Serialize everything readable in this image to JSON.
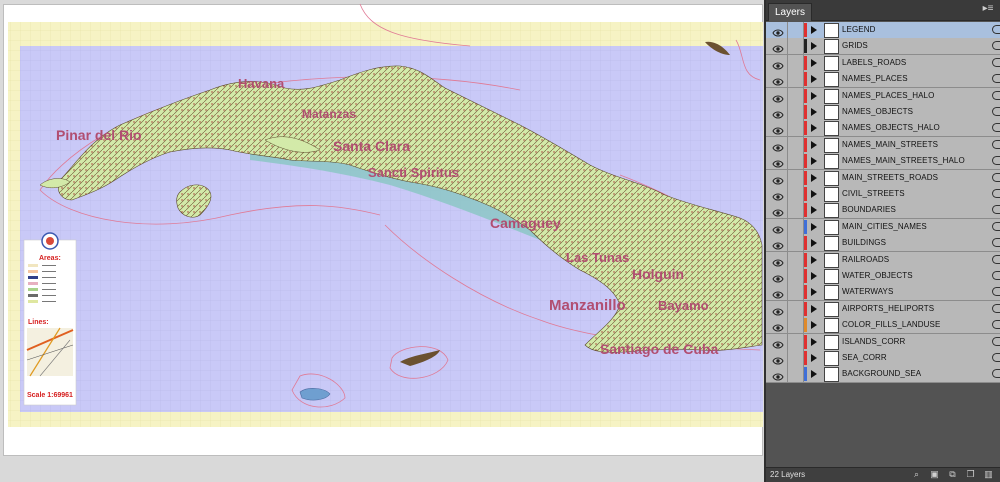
{
  "map": {
    "labels": {
      "havana": "Havana",
      "pinar": "Pinar del Rio",
      "matanzas": "Matanzas",
      "santa_clara": "Santa Clara",
      "sancti": "Sancti Spiritus",
      "camaguey": "Camaguey",
      "las_tunas": "Las Tunas",
      "holguin": "Holguin",
      "bayamo": "Bayamo",
      "manzanillo": "Manzanillo",
      "santiago": "Santiago de Cuba"
    },
    "legend": {
      "areas_title": "Areas:",
      "lines_title": "Lines:",
      "scale": "Scale 1:69961"
    },
    "colors": {
      "sea": "#c9c9f7",
      "land": "#d6ecb1",
      "halo": "#f6f3c4",
      "label": "#b14e71"
    }
  },
  "layers_panel": {
    "tab_label": "Layers",
    "menu_icon": "panel-menu-icon",
    "layer_count": "22 Layers",
    "layers": [
      {
        "name": "LEGEND",
        "color": "#e03030",
        "selected": true
      },
      {
        "name": "GRIDS",
        "color": "#222222",
        "selected": false
      },
      {
        "name": "LABELS_ROADS",
        "color": "#e03030",
        "selected": false
      },
      {
        "name": "NAMES_PLACES",
        "color": "#e03030",
        "selected": false
      },
      {
        "name": "NAMES_PLACES_HALO",
        "color": "#e03030",
        "selected": false
      },
      {
        "name": "NAMES_OBJECTS",
        "color": "#e03030",
        "selected": false
      },
      {
        "name": "NAMES_OBJECTS_HALO",
        "color": "#e03030",
        "selected": false
      },
      {
        "name": "NAMES_MAIN_STREETS",
        "color": "#e03030",
        "selected": false
      },
      {
        "name": "NAMES_MAIN_STREETS_HALO",
        "color": "#e03030",
        "selected": false
      },
      {
        "name": "MAIN_STREETS_ROADS",
        "color": "#e03030",
        "selected": false
      },
      {
        "name": "CIVIL_STREETS",
        "color": "#e03030",
        "selected": false
      },
      {
        "name": "BOUNDARIES",
        "color": "#e03030",
        "selected": false
      },
      {
        "name": "MAIN_CITIES_NAMES",
        "color": "#3f6fd8",
        "selected": false
      },
      {
        "name": "BUILDINGS",
        "color": "#e03030",
        "selected": false
      },
      {
        "name": "RAILROADS",
        "color": "#e03030",
        "selected": false
      },
      {
        "name": "WATER_OBJECTS",
        "color": "#e03030",
        "selected": false
      },
      {
        "name": "WATERWAYS",
        "color": "#e03030",
        "selected": false
      },
      {
        "name": "AIRPORTS_HELIPORTS",
        "color": "#e03030",
        "selected": false
      },
      {
        "name": "COLOR_FILLS_LANDUSE",
        "color": "#e08a2a",
        "selected": false
      },
      {
        "name": "ISLANDS_CORR",
        "color": "#e03030",
        "selected": false
      },
      {
        "name": "SEA_CORR",
        "color": "#e03030",
        "selected": false
      },
      {
        "name": "BACKGROUND_SEA",
        "color": "#3f6fd8",
        "selected": false
      }
    ]
  }
}
